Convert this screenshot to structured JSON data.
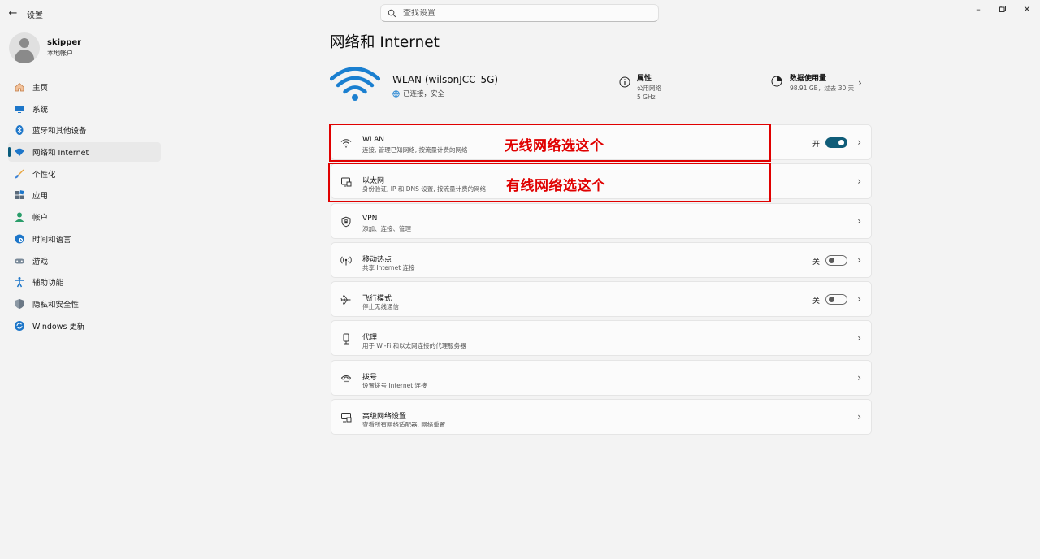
{
  "app": {
    "title": "设置"
  },
  "search": {
    "placeholder": "查找设置"
  },
  "profile": {
    "name": "skipper",
    "account_type": "本地帐户"
  },
  "sidebar": {
    "items": [
      {
        "label": "主页",
        "icon": "home-icon"
      },
      {
        "label": "系统",
        "icon": "monitor-icon"
      },
      {
        "label": "蓝牙和其他设备",
        "icon": "bluetooth-icon"
      },
      {
        "label": "网络和 Internet",
        "icon": "wifi-icon",
        "active": true
      },
      {
        "label": "个性化",
        "icon": "brush-icon"
      },
      {
        "label": "应用",
        "icon": "apps-icon"
      },
      {
        "label": "帐户",
        "icon": "account-icon"
      },
      {
        "label": "时间和语言",
        "icon": "globe-clock-icon"
      },
      {
        "label": "游戏",
        "icon": "gamepad-icon"
      },
      {
        "label": "辅助功能",
        "icon": "accessibility-icon"
      },
      {
        "label": "隐私和安全性",
        "icon": "shield-icon"
      },
      {
        "label": "Windows 更新",
        "icon": "update-icon"
      }
    ]
  },
  "page": {
    "title": "网络和 Internet"
  },
  "hero": {
    "network_name": "WLAN (wilsonJCC_5G)",
    "status": "已连接，安全",
    "properties": {
      "title": "属性",
      "lines": [
        "公用网络",
        "5 GHz"
      ]
    },
    "data_usage": {
      "title": "数据使用量",
      "value": "98.91 GB，过去 30 天"
    }
  },
  "cards": [
    {
      "title": "WLAN",
      "subtitle": "连接, 管理已知网络, 按流量计费的网络",
      "icon": "wifi-icon",
      "toggle": "on",
      "toggle_label": "开"
    },
    {
      "title": "以太网",
      "subtitle": "身份验证, IP 和 DNS 设置, 按流量计费的网络",
      "icon": "ethernet-icon"
    },
    {
      "title": "VPN",
      "subtitle": "添加、连接、管理",
      "icon": "vpn-shield-icon"
    },
    {
      "title": "移动热点",
      "subtitle": "共享 Internet 连接",
      "icon": "hotspot-icon",
      "toggle": "off",
      "toggle_label": "关"
    },
    {
      "title": "飞行模式",
      "subtitle": "停止无线通信",
      "icon": "airplane-icon",
      "toggle": "off",
      "toggle_label": "关"
    },
    {
      "title": "代理",
      "subtitle": "用于 Wi-Fi 和以太网连接的代理服务器",
      "icon": "proxy-icon"
    },
    {
      "title": "拨号",
      "subtitle": "设置拨号 Internet 连接",
      "icon": "dialup-icon"
    },
    {
      "title": "高级网络设置",
      "subtitle": "查看所有网络适配器, 网络重置",
      "icon": "network-adapter-icon"
    }
  ],
  "annotations": {
    "wireless": "无线网络选这个",
    "wired": "有线网络选这个",
    "color": "#e00000"
  },
  "colors": {
    "accent": "#0f5c78",
    "wifi_blue": "#1a7fd0"
  }
}
